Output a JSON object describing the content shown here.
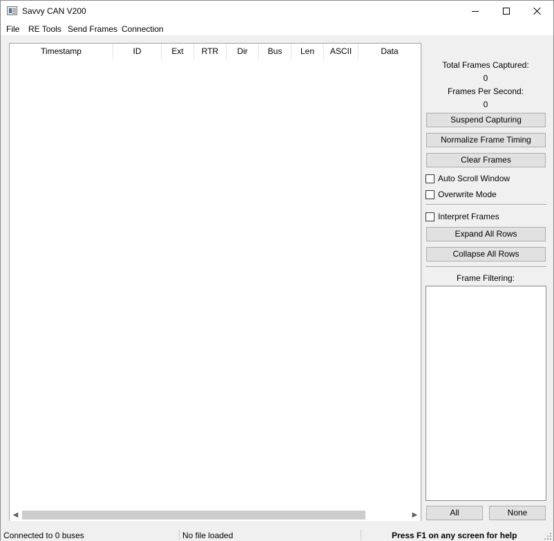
{
  "window": {
    "title": "Savvy CAN V200"
  },
  "menu": {
    "items": [
      {
        "label": "File"
      },
      {
        "label": "RE Tools"
      },
      {
        "label": "Send Frames"
      },
      {
        "label": "Connection"
      }
    ]
  },
  "table": {
    "columns": [
      "Timestamp",
      "ID",
      "Ext",
      "RTR",
      "Dir",
      "Bus",
      "Len",
      "ASCII",
      "Data"
    ],
    "rows": []
  },
  "side_panel": {
    "total_frames_label": "Total Frames Captured:",
    "total_frames_value": "0",
    "fps_label": "Frames Per Second:",
    "fps_value": "0",
    "suspend_button": "Suspend Capturing",
    "normalize_button": "Normalize Frame Timing",
    "clear_button": "Clear Frames",
    "auto_scroll_label": "Auto Scroll Window",
    "auto_scroll_checked": false,
    "overwrite_label": "Overwrite Mode",
    "overwrite_checked": false,
    "interpret_label": "Interpret Frames",
    "interpret_checked": false,
    "expand_button": "Expand All Rows",
    "collapse_button": "Collapse All Rows",
    "filtering_label": "Frame Filtering:",
    "filters": [],
    "all_button": "All",
    "none_button": "None"
  },
  "status": {
    "connection": "Connected to 0 buses",
    "file": "No file loaded",
    "help": "Press F1 on any screen for help"
  }
}
